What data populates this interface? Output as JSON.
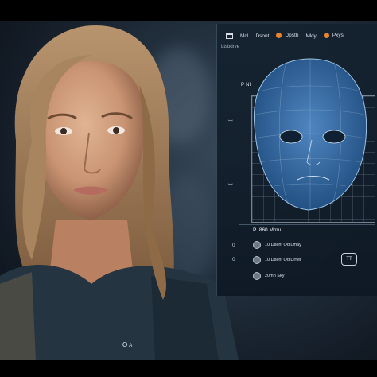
{
  "menu": {
    "items": [
      "Mdl",
      "Dsont",
      "Dpsth",
      "Mkly",
      "Pxys"
    ]
  },
  "subtitle": "Ltsbdrve",
  "scan_label": "P NI",
  "info": {
    "title": "P .860 Mrnu",
    "rows": [
      "10 Dsent Od Lmay",
      "10 Dsent Od Drfier",
      "20mn Sky"
    ],
    "button_label": "TT",
    "side_numbers": [
      "0",
      "0"
    ]
  },
  "caption": {
    "main": "O",
    "sub": "A"
  },
  "colors": {
    "accent": "#e8842e",
    "panel": "#142230",
    "wireframe": "#2e6aa8"
  }
}
